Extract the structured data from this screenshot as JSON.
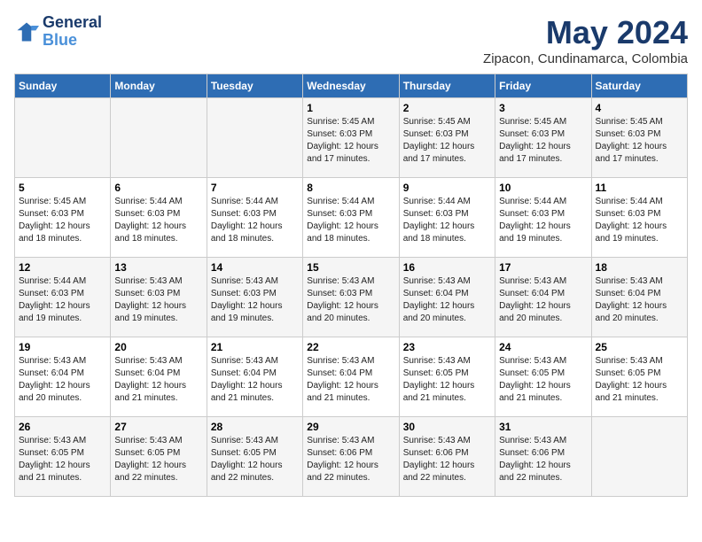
{
  "header": {
    "logo_line1": "General",
    "logo_line2": "Blue",
    "title": "May 2024",
    "subtitle": "Zipacon, Cundinamarca, Colombia"
  },
  "days_of_week": [
    "Sunday",
    "Monday",
    "Tuesday",
    "Wednesday",
    "Thursday",
    "Friday",
    "Saturday"
  ],
  "weeks": [
    [
      {
        "day": "",
        "info": ""
      },
      {
        "day": "",
        "info": ""
      },
      {
        "day": "",
        "info": ""
      },
      {
        "day": "1",
        "info": "Sunrise: 5:45 AM\nSunset: 6:03 PM\nDaylight: 12 hours\nand 17 minutes."
      },
      {
        "day": "2",
        "info": "Sunrise: 5:45 AM\nSunset: 6:03 PM\nDaylight: 12 hours\nand 17 minutes."
      },
      {
        "day": "3",
        "info": "Sunrise: 5:45 AM\nSunset: 6:03 PM\nDaylight: 12 hours\nand 17 minutes."
      },
      {
        "day": "4",
        "info": "Sunrise: 5:45 AM\nSunset: 6:03 PM\nDaylight: 12 hours\nand 17 minutes."
      }
    ],
    [
      {
        "day": "5",
        "info": "Sunrise: 5:45 AM\nSunset: 6:03 PM\nDaylight: 12 hours\nand 18 minutes."
      },
      {
        "day": "6",
        "info": "Sunrise: 5:44 AM\nSunset: 6:03 PM\nDaylight: 12 hours\nand 18 minutes."
      },
      {
        "day": "7",
        "info": "Sunrise: 5:44 AM\nSunset: 6:03 PM\nDaylight: 12 hours\nand 18 minutes."
      },
      {
        "day": "8",
        "info": "Sunrise: 5:44 AM\nSunset: 6:03 PM\nDaylight: 12 hours\nand 18 minutes."
      },
      {
        "day": "9",
        "info": "Sunrise: 5:44 AM\nSunset: 6:03 PM\nDaylight: 12 hours\nand 18 minutes."
      },
      {
        "day": "10",
        "info": "Sunrise: 5:44 AM\nSunset: 6:03 PM\nDaylight: 12 hours\nand 19 minutes."
      },
      {
        "day": "11",
        "info": "Sunrise: 5:44 AM\nSunset: 6:03 PM\nDaylight: 12 hours\nand 19 minutes."
      }
    ],
    [
      {
        "day": "12",
        "info": "Sunrise: 5:44 AM\nSunset: 6:03 PM\nDaylight: 12 hours\nand 19 minutes."
      },
      {
        "day": "13",
        "info": "Sunrise: 5:43 AM\nSunset: 6:03 PM\nDaylight: 12 hours\nand 19 minutes."
      },
      {
        "day": "14",
        "info": "Sunrise: 5:43 AM\nSunset: 6:03 PM\nDaylight: 12 hours\nand 19 minutes."
      },
      {
        "day": "15",
        "info": "Sunrise: 5:43 AM\nSunset: 6:03 PM\nDaylight: 12 hours\nand 20 minutes."
      },
      {
        "day": "16",
        "info": "Sunrise: 5:43 AM\nSunset: 6:04 PM\nDaylight: 12 hours\nand 20 minutes."
      },
      {
        "day": "17",
        "info": "Sunrise: 5:43 AM\nSunset: 6:04 PM\nDaylight: 12 hours\nand 20 minutes."
      },
      {
        "day": "18",
        "info": "Sunrise: 5:43 AM\nSunset: 6:04 PM\nDaylight: 12 hours\nand 20 minutes."
      }
    ],
    [
      {
        "day": "19",
        "info": "Sunrise: 5:43 AM\nSunset: 6:04 PM\nDaylight: 12 hours\nand 20 minutes."
      },
      {
        "day": "20",
        "info": "Sunrise: 5:43 AM\nSunset: 6:04 PM\nDaylight: 12 hours\nand 21 minutes."
      },
      {
        "day": "21",
        "info": "Sunrise: 5:43 AM\nSunset: 6:04 PM\nDaylight: 12 hours\nand 21 minutes."
      },
      {
        "day": "22",
        "info": "Sunrise: 5:43 AM\nSunset: 6:04 PM\nDaylight: 12 hours\nand 21 minutes."
      },
      {
        "day": "23",
        "info": "Sunrise: 5:43 AM\nSunset: 6:05 PM\nDaylight: 12 hours\nand 21 minutes."
      },
      {
        "day": "24",
        "info": "Sunrise: 5:43 AM\nSunset: 6:05 PM\nDaylight: 12 hours\nand 21 minutes."
      },
      {
        "day": "25",
        "info": "Sunrise: 5:43 AM\nSunset: 6:05 PM\nDaylight: 12 hours\nand 21 minutes."
      }
    ],
    [
      {
        "day": "26",
        "info": "Sunrise: 5:43 AM\nSunset: 6:05 PM\nDaylight: 12 hours\nand 21 minutes."
      },
      {
        "day": "27",
        "info": "Sunrise: 5:43 AM\nSunset: 6:05 PM\nDaylight: 12 hours\nand 22 minutes."
      },
      {
        "day": "28",
        "info": "Sunrise: 5:43 AM\nSunset: 6:05 PM\nDaylight: 12 hours\nand 22 minutes."
      },
      {
        "day": "29",
        "info": "Sunrise: 5:43 AM\nSunset: 6:06 PM\nDaylight: 12 hours\nand 22 minutes."
      },
      {
        "day": "30",
        "info": "Sunrise: 5:43 AM\nSunset: 6:06 PM\nDaylight: 12 hours\nand 22 minutes."
      },
      {
        "day": "31",
        "info": "Sunrise: 5:43 AM\nSunset: 6:06 PM\nDaylight: 12 hours\nand 22 minutes."
      },
      {
        "day": "",
        "info": ""
      }
    ]
  ]
}
